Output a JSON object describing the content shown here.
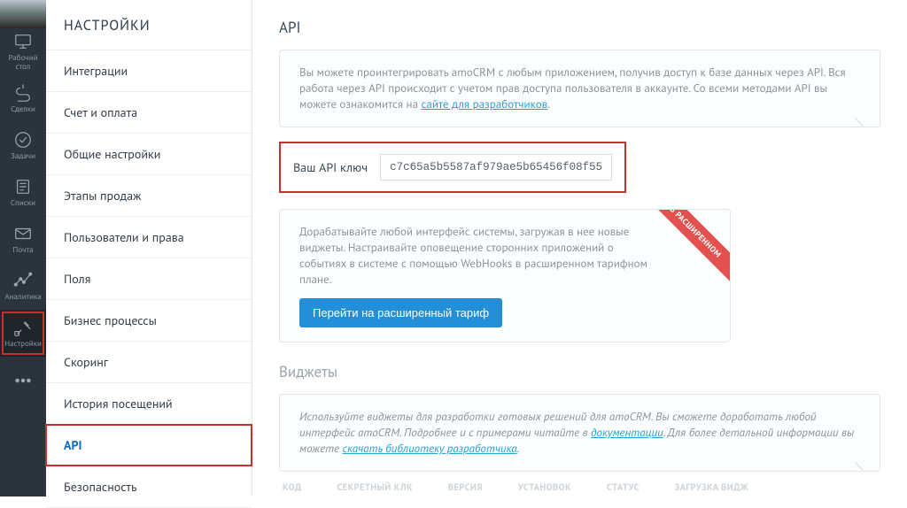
{
  "rail": {
    "items": [
      {
        "name": "desktop",
        "label": "Рабочий\nстол"
      },
      {
        "name": "deals",
        "label": "Сделки"
      },
      {
        "name": "tasks",
        "label": "Задачи"
      },
      {
        "name": "lists",
        "label": "Списки"
      },
      {
        "name": "mail",
        "label": "Почта"
      },
      {
        "name": "analytics",
        "label": "Аналитика"
      },
      {
        "name": "settings",
        "label": "Настройки",
        "active": true
      },
      {
        "name": "more",
        "label": ""
      }
    ]
  },
  "side": {
    "title": "НАСТРОЙКИ",
    "items": [
      {
        "label": "Интеграции"
      },
      {
        "label": "Счет и оплата"
      },
      {
        "label": "Общие настройки"
      },
      {
        "label": "Этапы продаж"
      },
      {
        "label": "Пользователи и права"
      },
      {
        "label": "Поля"
      },
      {
        "label": "Бизнес процессы"
      },
      {
        "label": "Скоринг"
      },
      {
        "label": "История посещений"
      },
      {
        "label": "API",
        "active": true
      },
      {
        "label": "Безопасность"
      }
    ]
  },
  "main": {
    "api_heading": "API",
    "intro_a": "Вы можете проинтегрировать amoCRM с любым приложением, получив доступ к базе данных через API. Вся работа через API происходит с учетом прав доступа пользователя в аккаунте. Со всеми методами API вы можете ознакомится на ",
    "intro_link": "сайте для разработчиков",
    "intro_b": ".",
    "key_label": "Ваш API ключ",
    "key_value": "c7c65a5b5587af979ae5b65456f08f55",
    "upsell": "Дорабатывайте любой интерфейс системы, загружая в нее новые виджеты. Настраивайте оповещение сторонних приложений о событиях в системе с помощью WebHooks в расширенном тарифном плане.",
    "ribbon": "В РАСШИРЕННОМ",
    "btn": "Перейти на расширенный тариф",
    "widgets_heading": "Виджеты",
    "widgets_a": "Используйте виджеты для разработки готовых решений для amoCRM. Вы сможете доработать любой интерфейс amoCRM. Подробнее и с примерами читайте в ",
    "widgets_link1": "документации",
    "widgets_b": ". Для более детальной информации вы можете ",
    "widgets_link2": "скачать библиотеку разработчика",
    "widgets_c": ".",
    "table": {
      "h1": "КОД",
      "h2": "СЕКРЕТНЫЙ КЛК",
      "h3": "ВЕРСИЯ",
      "h4": "УСТАНОВОК",
      "h5": "СТАТУС",
      "h6": "ЗАГРУЗКА ВИДЖ"
    }
  }
}
